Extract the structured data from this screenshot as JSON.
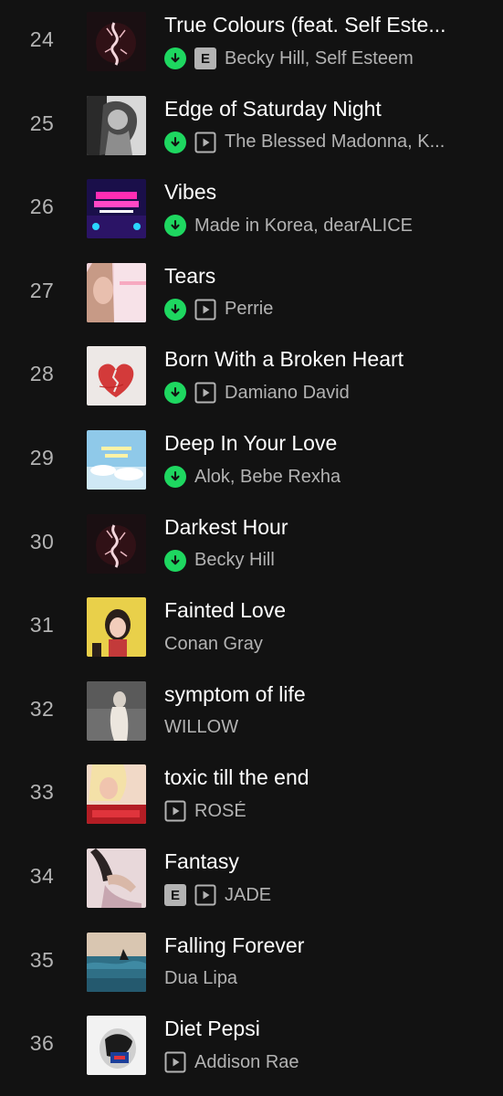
{
  "tracks": [
    {
      "rank": "24",
      "title": "True Colours (feat. Self Este...",
      "artist": "Becky Hill, Self Esteem",
      "downloaded": true,
      "explicit": true,
      "video": false,
      "cover": "darkest-hour-cover"
    },
    {
      "rank": "25",
      "title": "Edge of Saturday Night",
      "artist": "The Blessed Madonna, K...",
      "downloaded": true,
      "explicit": false,
      "video": true,
      "cover": "bw-photo-cover"
    },
    {
      "rank": "26",
      "title": "Vibes",
      "artist": "Made in Korea, dearALICE",
      "downloaded": true,
      "explicit": false,
      "video": false,
      "cover": "neon-title-cover"
    },
    {
      "rank": "27",
      "title": "Tears",
      "artist": "Perrie",
      "downloaded": true,
      "explicit": false,
      "video": true,
      "cover": "pink-portrait-cover"
    },
    {
      "rank": "28",
      "title": "Born With a Broken Heart",
      "artist": "Damiano David",
      "downloaded": true,
      "explicit": false,
      "video": true,
      "cover": "broken-heart-cover"
    },
    {
      "rank": "29",
      "title": "Deep In Your Love",
      "artist": "Alok, Bebe Rexha",
      "downloaded": true,
      "explicit": false,
      "video": false,
      "cover": "sky-cover"
    },
    {
      "rank": "30",
      "title": "Darkest Hour",
      "artist": "Becky Hill",
      "downloaded": true,
      "explicit": false,
      "video": false,
      "cover": "darkest-hour-cover"
    },
    {
      "rank": "31",
      "title": "Fainted Love",
      "artist": "Conan Gray",
      "downloaded": false,
      "explicit": false,
      "video": false,
      "cover": "yellow-portrait-cover"
    },
    {
      "rank": "32",
      "title": "symptom of life",
      "artist": "WILLOW",
      "downloaded": false,
      "explicit": false,
      "video": false,
      "cover": "grey-figure-cover"
    },
    {
      "rank": "33",
      "title": "toxic till the end",
      "artist": "ROSÉ",
      "downloaded": false,
      "explicit": false,
      "video": true,
      "cover": "rose-cover"
    },
    {
      "rank": "34",
      "title": "Fantasy",
      "artist": "JADE",
      "downloaded": false,
      "explicit": true,
      "video": true,
      "cover": "jade-cover"
    },
    {
      "rank": "35",
      "title": "Falling Forever",
      "artist": "Dua Lipa",
      "downloaded": false,
      "explicit": false,
      "video": false,
      "cover": "ocean-cover"
    },
    {
      "rank": "36",
      "title": "Diet Pepsi",
      "artist": "Addison Rae",
      "downloaded": false,
      "explicit": false,
      "video": true,
      "cover": "diet-pepsi-cover"
    }
  ],
  "colors": {
    "background": "#121212",
    "accent": "#1ed760",
    "secondary_text": "#b3b3b3",
    "primary_text": "#ffffff"
  },
  "icons": {
    "download": "download-arrow-icon",
    "explicit": "explicit-badge-icon",
    "video": "video-play-icon"
  },
  "labels": {
    "explicit_letter": "E"
  }
}
